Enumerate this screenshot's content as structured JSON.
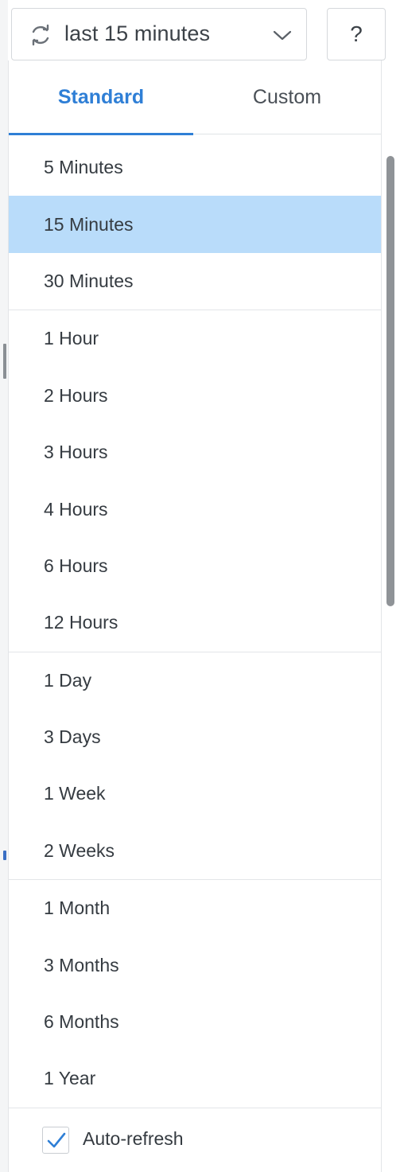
{
  "trigger": {
    "refresh_icon": "refresh-icon",
    "label": "last 15 minutes",
    "chevron_icon": "chevron-down-icon"
  },
  "help": {
    "label": "?"
  },
  "tabs": [
    {
      "label": "Standard",
      "active": true
    },
    {
      "label": "Custom",
      "active": false
    }
  ],
  "option_groups": [
    {
      "options": [
        {
          "label": "5 Minutes",
          "selected": false
        },
        {
          "label": "15 Minutes",
          "selected": true
        },
        {
          "label": "30 Minutes",
          "selected": false
        }
      ]
    },
    {
      "options": [
        {
          "label": "1 Hour",
          "selected": false
        },
        {
          "label": "2 Hours",
          "selected": false
        },
        {
          "label": "3 Hours",
          "selected": false
        },
        {
          "label": "4 Hours",
          "selected": false
        },
        {
          "label": "6 Hours",
          "selected": false
        },
        {
          "label": "12 Hours",
          "selected": false
        }
      ]
    },
    {
      "options": [
        {
          "label": "1 Day",
          "selected": false
        },
        {
          "label": "3 Days",
          "selected": false
        },
        {
          "label": "1 Week",
          "selected": false
        },
        {
          "label": "2 Weeks",
          "selected": false
        }
      ]
    },
    {
      "options": [
        {
          "label": "1 Month",
          "selected": false
        },
        {
          "label": "3 Months",
          "selected": false
        },
        {
          "label": "6 Months",
          "selected": false
        },
        {
          "label": "1 Year",
          "selected": false
        }
      ]
    }
  ],
  "auto_refresh": {
    "label": "Auto-refresh",
    "checked": true
  },
  "colors": {
    "accent": "#2f7fd6",
    "selected_row": "#b9dcfa",
    "text": "#353b41",
    "border": "#e3e5e8"
  }
}
